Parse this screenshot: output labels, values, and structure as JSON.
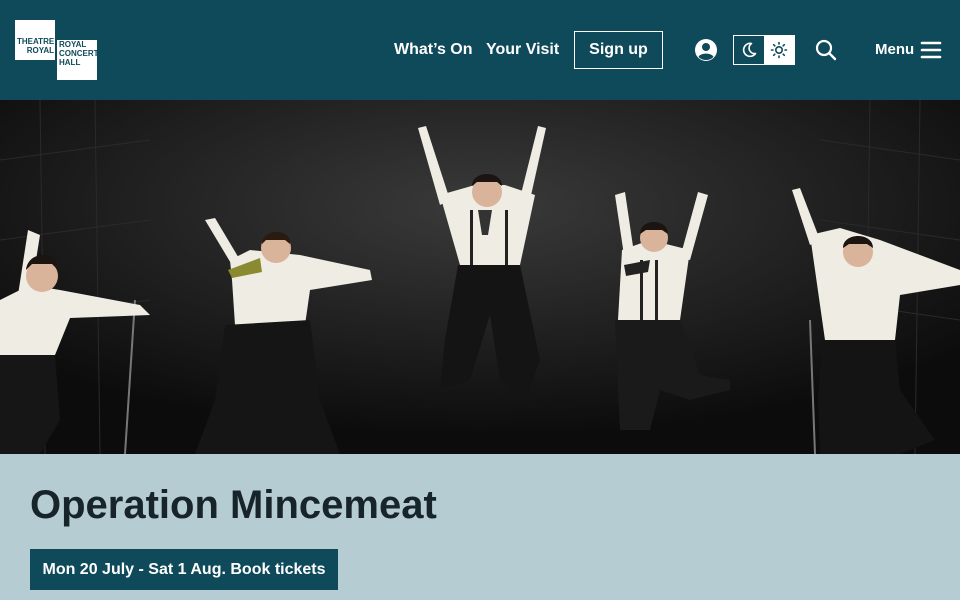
{
  "header": {
    "logo": {
      "tile1_lines": [
        "THEATRE",
        "ROYAL"
      ],
      "tile2_lines": [
        "ROYAL",
        "CONCERT",
        "HALL"
      ],
      "bg_color": "#0f4a5a"
    },
    "nav": [
      {
        "label": "What’s On"
      },
      {
        "label": "Your Visit"
      }
    ],
    "signup_label": "Sign up",
    "icons": {
      "account": "account-icon",
      "theme_dark": "moon-icon",
      "theme_light": "sun-icon",
      "search": "search-icon",
      "menu": "hamburger-icon"
    },
    "menu_label": "Menu"
  },
  "hero": {
    "image": "Performers in white shirts and black trousers jumping on a dark stage"
  },
  "event": {
    "title": "Operation Mincemeat",
    "cta_label": "Mon 20 July - Sat 1 Aug. Book tickets",
    "cta_color": "#0f4a5a",
    "panel_color": "#b6ccd3"
  }
}
